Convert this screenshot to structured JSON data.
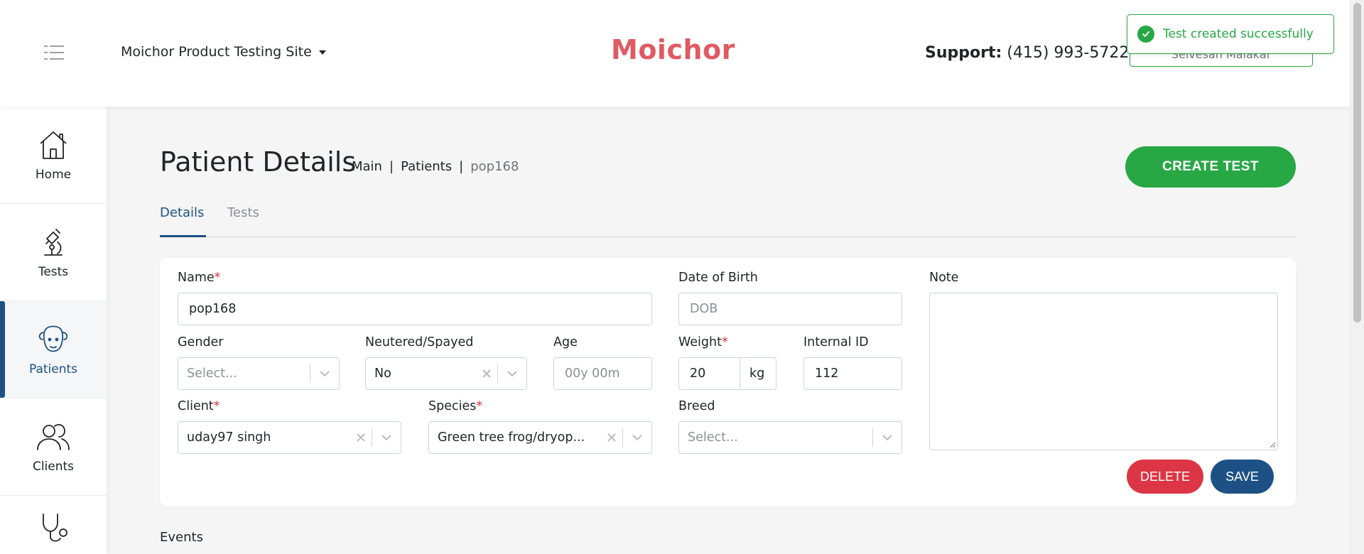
{
  "header": {
    "site_name": "Moichor Product Testing Site",
    "logo_text": "Moichor",
    "support_label": "Support:",
    "support_phone": "(415) 993-5722",
    "user_name": "Selvesan Malakar"
  },
  "toast": {
    "message": "Test created successfully"
  },
  "sidebar": {
    "items": [
      {
        "label": "Home",
        "icon": "home-icon"
      },
      {
        "label": "Tests",
        "icon": "microscope-icon"
      },
      {
        "label": "Patients",
        "icon": "sheep-icon"
      },
      {
        "label": "Clients",
        "icon": "clients-icon"
      },
      {
        "label": "",
        "icon": "stethoscope-icon"
      }
    ]
  },
  "page": {
    "title": "Patient Details",
    "breadcrumb": {
      "main": "Main",
      "patients": "Patients",
      "current": "pop168",
      "separator": "|"
    },
    "create_test_label": "CREATE TEST",
    "tabs": [
      {
        "label": "Details"
      },
      {
        "label": "Tests"
      }
    ],
    "events_label": "Events"
  },
  "form": {
    "name": {
      "label": "Name",
      "value": "pop168"
    },
    "dob": {
      "label": "Date of Birth",
      "placeholder": "DOB"
    },
    "note": {
      "label": "Note"
    },
    "gender": {
      "label": "Gender",
      "placeholder": "Select..."
    },
    "neutered": {
      "label": "Neutered/Spayed",
      "value": "No"
    },
    "age": {
      "label": "Age",
      "placeholder": "00y 00m"
    },
    "weight": {
      "label": "Weight",
      "value": "20",
      "unit": "kg"
    },
    "internal_id": {
      "label": "Internal ID",
      "value": "112"
    },
    "client": {
      "label": "Client",
      "value": "uday97 singh"
    },
    "species": {
      "label": "Species",
      "value": "Green tree frog/dryop..."
    },
    "breed": {
      "label": "Breed",
      "placeholder": "Select..."
    },
    "required_mark": "*",
    "delete_label": "DELETE",
    "save_label": "SAVE"
  },
  "colors": {
    "accent_green": "#28a745",
    "primary_blue": "#1d5185",
    "danger_red": "#dc3545",
    "logo_red": "#e05a63"
  }
}
